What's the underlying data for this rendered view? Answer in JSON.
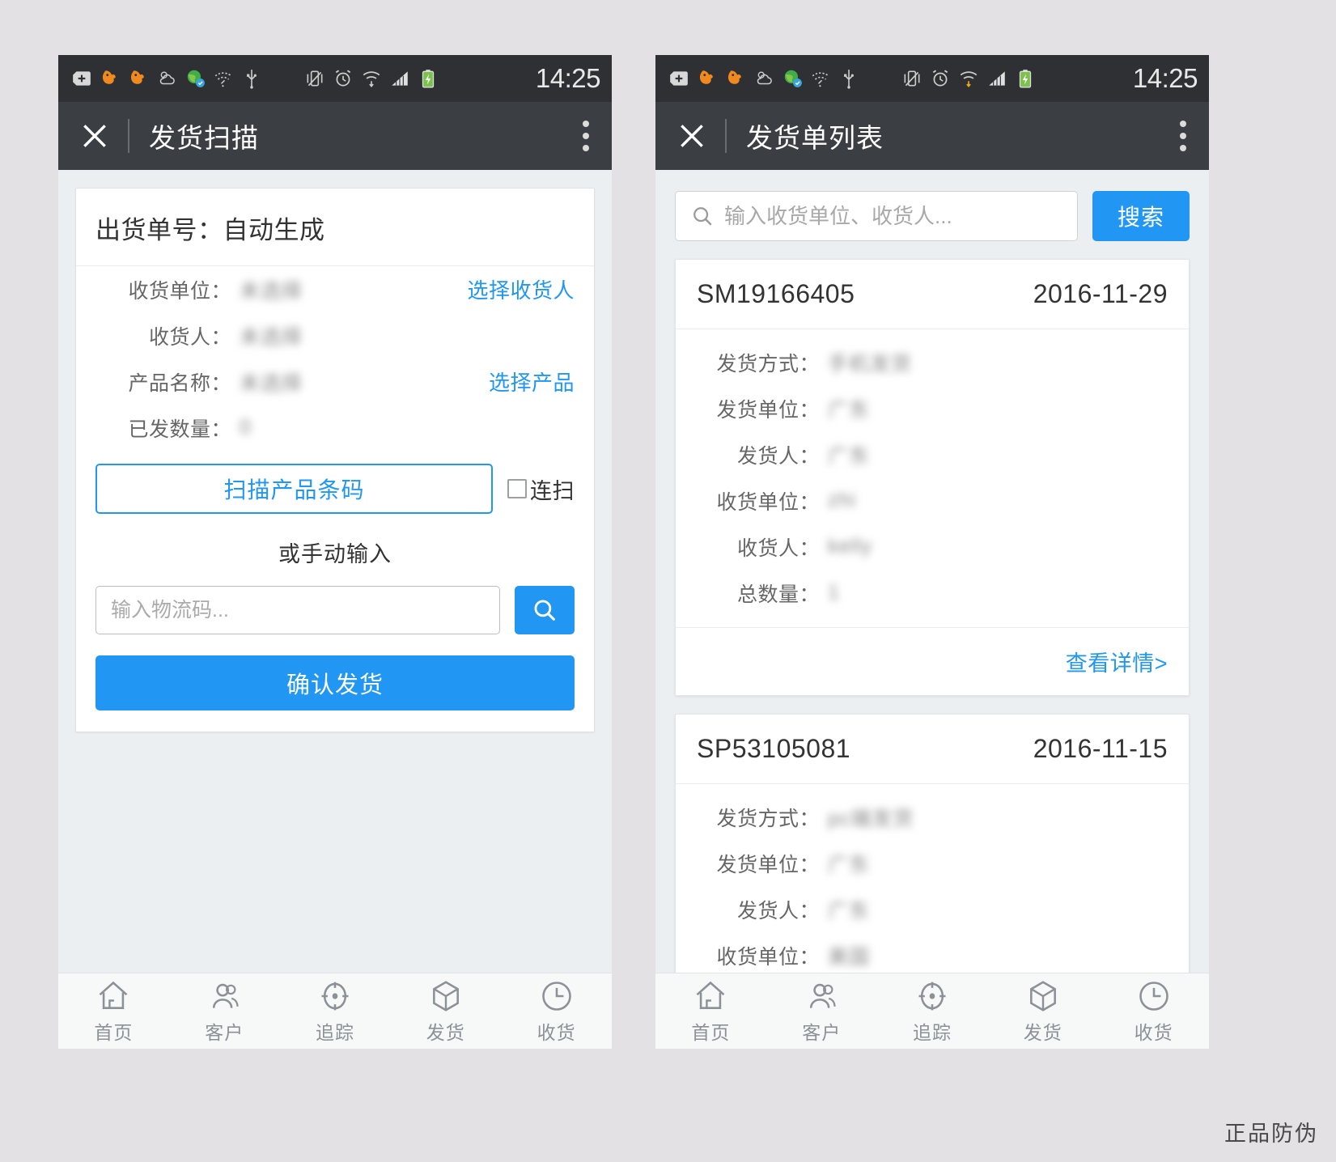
{
  "statusbar": {
    "time": "14:25",
    "icons": [
      "plus-badge-icon",
      "uc-browser-icon",
      "uc-browser-icon",
      "weather-cloud-icon",
      "globe-sync-icon",
      "wifi-question-icon",
      "usb-icon",
      "vibrate-off-icon",
      "alarm-clock-icon",
      "wifi-arrows-icon",
      "signal-bars-icon",
      "battery-charging-icon"
    ]
  },
  "left": {
    "appbar": {
      "close_icon": "close-icon",
      "title": "发货扫描",
      "menu_icon": "kebab-menu-icon"
    },
    "form": {
      "header": "出货单号：自动生成",
      "fields": [
        {
          "label": "收货单位：",
          "value": "未选择",
          "link": "选择收货人"
        },
        {
          "label": "收货人：",
          "value": "未选择",
          "link": ""
        },
        {
          "label": "产品名称：",
          "value": "未选择",
          "link": "选择产品"
        },
        {
          "label": "已发数量：",
          "value": "0",
          "link": ""
        }
      ],
      "scan_button": "扫描产品条码",
      "continuous_label": "连扫",
      "manual_hint": "或手动输入",
      "logistics_placeholder": "输入物流码...",
      "search_icon": "search-icon",
      "confirm_button": "确认发货"
    }
  },
  "right": {
    "appbar": {
      "close_icon": "close-icon",
      "title": "发货单列表",
      "menu_icon": "kebab-menu-icon"
    },
    "search": {
      "icon": "search-icon",
      "placeholder": "输入收货单位、收货人...",
      "button": "搜索"
    },
    "orders": [
      {
        "number": "SM19166405",
        "date": "2016-11-29",
        "rows": [
          {
            "label": "发货方式：",
            "value": "手机发货"
          },
          {
            "label": "发货单位：",
            "value": "广东"
          },
          {
            "label": "发货人：",
            "value": "广东"
          },
          {
            "label": "收货单位：",
            "value": "zhi"
          },
          {
            "label": "收货人：",
            "value": "kelly"
          },
          {
            "label": "总数量：",
            "value": "1"
          }
        ],
        "detail_link": "查看详情>"
      },
      {
        "number": "SP53105081",
        "date": "2016-11-15",
        "rows": [
          {
            "label": "发货方式：",
            "value": "pc端发货"
          },
          {
            "label": "发货单位：",
            "value": "广东"
          },
          {
            "label": "发货人：",
            "value": "广东"
          },
          {
            "label": "收货单位：",
            "value": "美国"
          }
        ],
        "detail_link": ""
      }
    ]
  },
  "tabbar": {
    "items": [
      {
        "icon": "home-icon",
        "label": "首页"
      },
      {
        "icon": "users-icon",
        "label": "客户"
      },
      {
        "icon": "target-icon",
        "label": "追踪"
      },
      {
        "icon": "cube-icon",
        "label": "发货"
      },
      {
        "icon": "clock-icon",
        "label": "收货"
      }
    ]
  },
  "watermark": "正品防伪",
  "colors": {
    "accent": "#2196f3",
    "appbar": "#3b3e42",
    "statusbar": "#2e3033",
    "page_bg": "#eceff1"
  }
}
